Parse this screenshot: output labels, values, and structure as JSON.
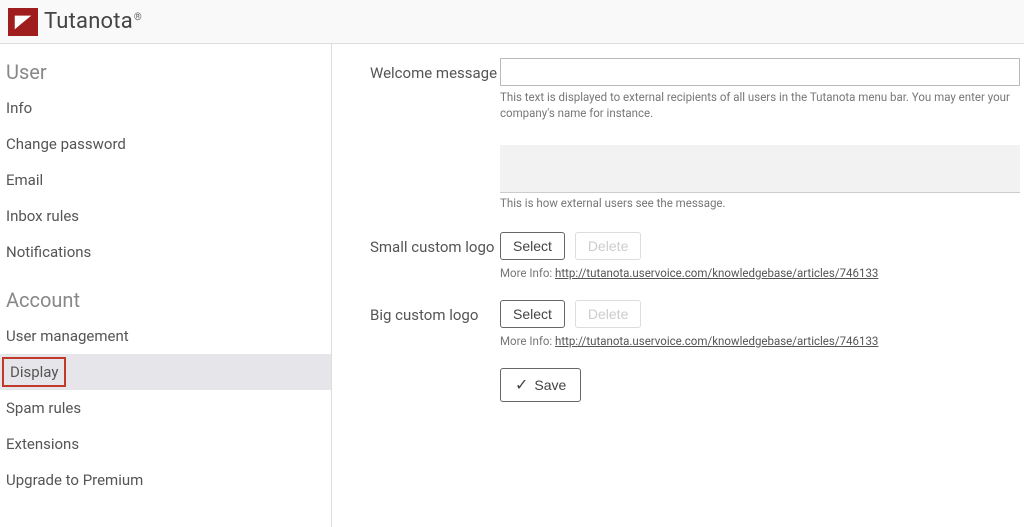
{
  "brand": {
    "name": "Tutanota",
    "reg": "®"
  },
  "sidebar": {
    "sections": [
      {
        "title": "User",
        "items": [
          {
            "label": "Info"
          },
          {
            "label": "Change password"
          },
          {
            "label": "Email"
          },
          {
            "label": "Inbox rules"
          },
          {
            "label": "Notifications"
          }
        ]
      },
      {
        "title": "Account",
        "items": [
          {
            "label": "User management"
          },
          {
            "label": "Display",
            "active": true,
            "highlight": true
          },
          {
            "label": "Spam rules"
          },
          {
            "label": "Extensions"
          },
          {
            "label": "Upgrade to Premium"
          }
        ]
      }
    ]
  },
  "form": {
    "welcome": {
      "label": "Welcome message",
      "value": "",
      "helper": "This text is displayed to external recipients of all users in the Tutanota menu bar. You may enter your company's name for instance.",
      "preview_helper": "This is how external users see the message."
    },
    "small_logo": {
      "label": "Small custom logo",
      "select": "Select",
      "delete": "Delete",
      "more_prefix": "More Info: ",
      "more_url": "http://tutanota.uservoice.com/knowledgebase/articles/746133"
    },
    "big_logo": {
      "label": "Big custom logo",
      "select": "Select",
      "delete": "Delete",
      "more_prefix": "More Info: ",
      "more_url": "http://tutanota.uservoice.com/knowledgebase/articles/746133"
    },
    "save": "Save"
  }
}
